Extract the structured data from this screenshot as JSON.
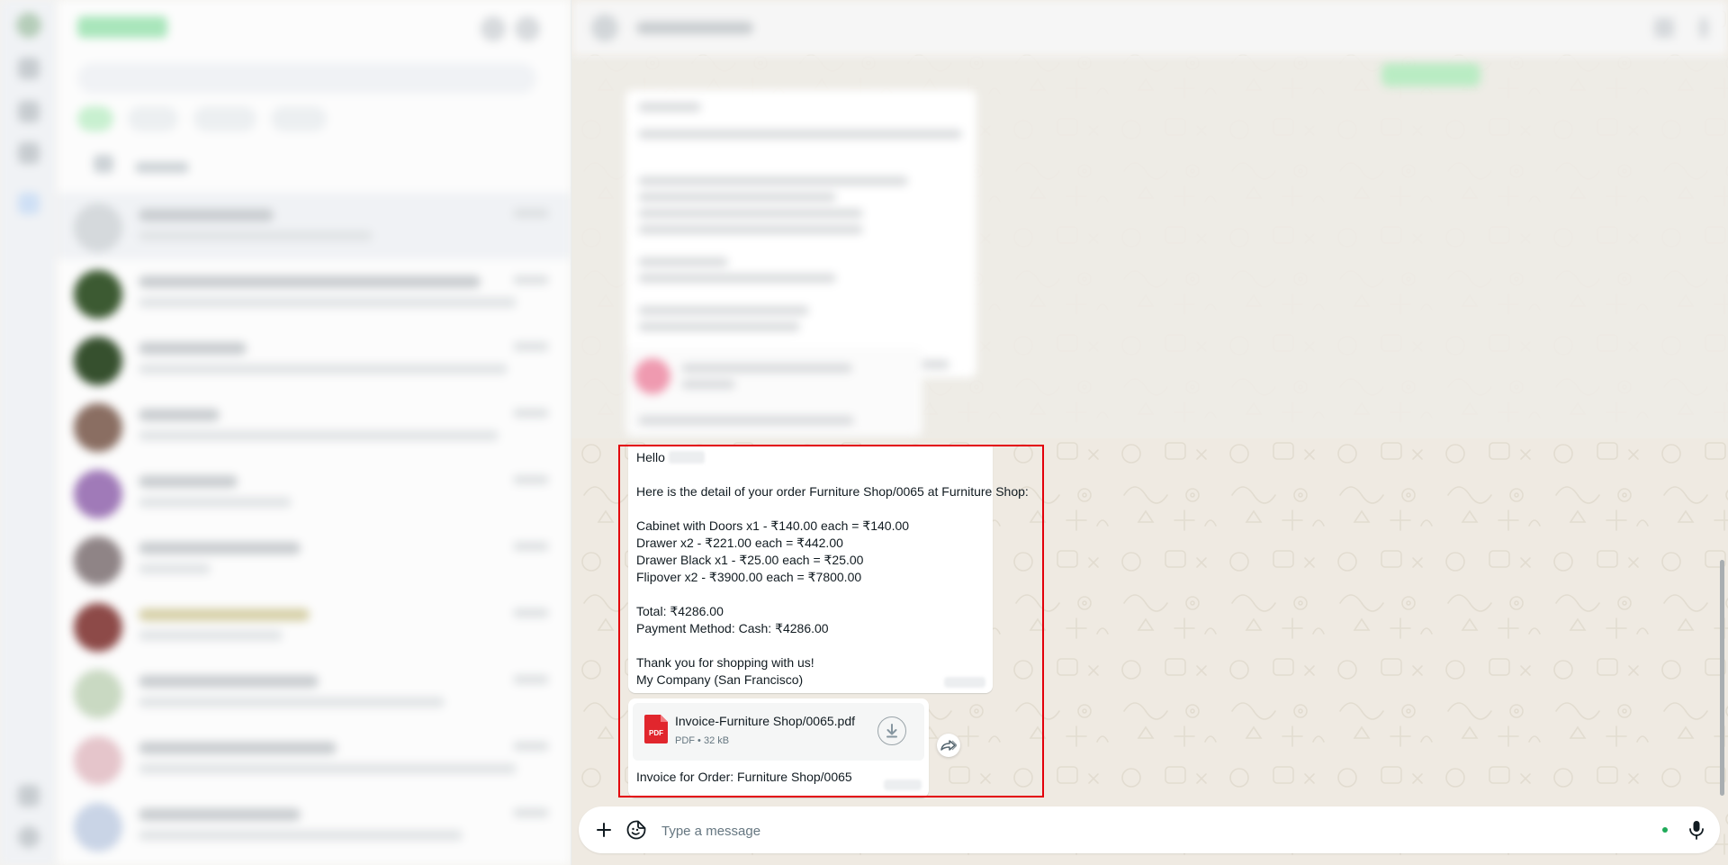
{
  "message": {
    "greeting": "Hello",
    "intro": "Here is the detail of your order Furniture Shop/0065 at Furniture Shop:",
    "items": [
      "Cabinet with Doors x1 - ₹140.00 each = ₹140.00",
      "Drawer x2 - ₹221.00 each = ₹442.00",
      "Drawer Black x1 - ₹25.00 each = ₹25.00",
      "Flipover x2 - ₹3900.00 each = ₹7800.00"
    ],
    "total": "Total: ₹4286.00",
    "payment": "Payment Method: Cash: ₹4286.00",
    "thanks": "Thank you for shopping with us!",
    "signature": "My Company (San Francisco)"
  },
  "attachment": {
    "filename": "Invoice-Furniture Shop/0065.pdf",
    "type_badge": "PDF",
    "meta": "PDF • 32 kB",
    "caption": "Invoice for Order: Furniture Shop/0065"
  },
  "composer": {
    "placeholder": "Type a message"
  },
  "colors": {
    "accent_green": "#25d366",
    "highlight_red": "#e3000b",
    "pdf_red": "#e1262d",
    "online_dot": "#1faa59"
  },
  "icons": {
    "attach": "plus-icon",
    "sticker": "sticker-icon",
    "mic": "microphone-icon",
    "download": "download-icon",
    "forward": "forward-icon",
    "pdf": "pdf-file-icon"
  }
}
